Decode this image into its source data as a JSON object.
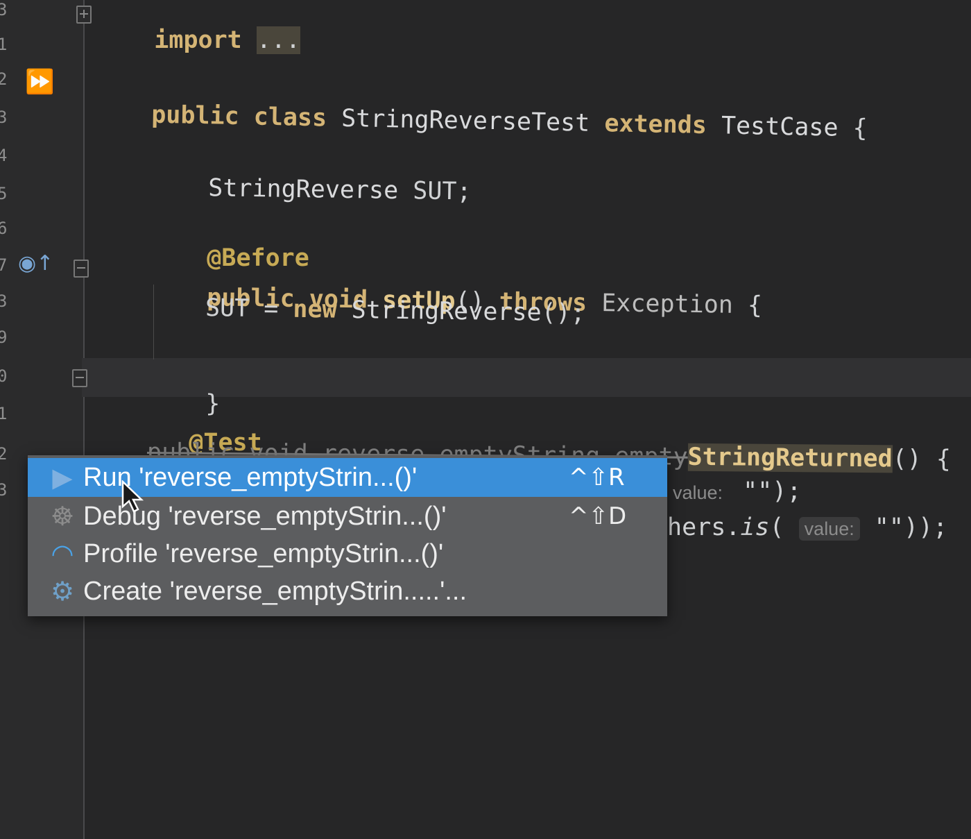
{
  "gutter": {
    "line_numbers": [
      "3",
      "1",
      "2",
      "3",
      "4",
      "5",
      "6",
      "7",
      "3",
      "9",
      "0",
      "1",
      "2",
      "3"
    ],
    "icons": {
      "run_class": "run-all-tests-icon",
      "override": "override-method-icon",
      "run_method": "run-test-icon"
    }
  },
  "code": {
    "line_import": {
      "kw": "import",
      "folded": "..."
    },
    "line_class": {
      "kw1": "public",
      "kw2": "class",
      "name": "StringReverseTest",
      "kw3": "extends",
      "parent": "TestCase",
      "brace": "{"
    },
    "line_field": {
      "type": "StringReverse",
      "name": "SUT",
      "semi": ";"
    },
    "line_before": {
      "annotation": "@Before"
    },
    "line_setup": {
      "kw1": "public",
      "kw2": "void",
      "name": "setUp",
      "parens": "()",
      "kw3": "throws",
      "exception": "Exception",
      "brace": "{"
    },
    "line_assign": {
      "lhs": "SUT = ",
      "kw": "new",
      "ctor": "StringReverse",
      "rest": "();"
    },
    "line_close": {
      "brace": "}"
    },
    "line_test": {
      "annotation": "@Test"
    },
    "line_testdecl": {
      "hidden": "public void reverse_emptyString_empty",
      "visible": "StringReturned",
      "tail": "() {"
    },
    "line_partial1": {
      "hint": "value:",
      "literal": " \"\");"
    },
    "line_partial2": {
      "prefix": "hers.",
      "method": "is",
      "open": "( ",
      "hint": "value:",
      "literal": " \"\"));"
    }
  },
  "context_menu": {
    "items": [
      {
        "icon": "run-icon",
        "glyph": "▶",
        "label": "Run 'reverse_emptyStrin...()'",
        "shortcut": "^⇧R",
        "selected": true
      },
      {
        "icon": "debug-icon",
        "glyph": "☸",
        "label": "Debug 'reverse_emptyStrin...()'",
        "shortcut": "^⇧D",
        "selected": false
      },
      {
        "icon": "profile-icon",
        "glyph": "◠",
        "label": "Profile 'reverse_emptyStrin...()'",
        "shortcut": "",
        "selected": false
      },
      {
        "icon": "create-config-icon",
        "glyph": "⚙",
        "label": "Create 'reverse_emptyStrin.....'...",
        "shortcut": "",
        "selected": false
      }
    ]
  },
  "colors": {
    "editor_bg": "#262627",
    "keyword": "#d4b475",
    "menu_bg": "#5c5d5f",
    "menu_selected": "#3a8fd9"
  }
}
